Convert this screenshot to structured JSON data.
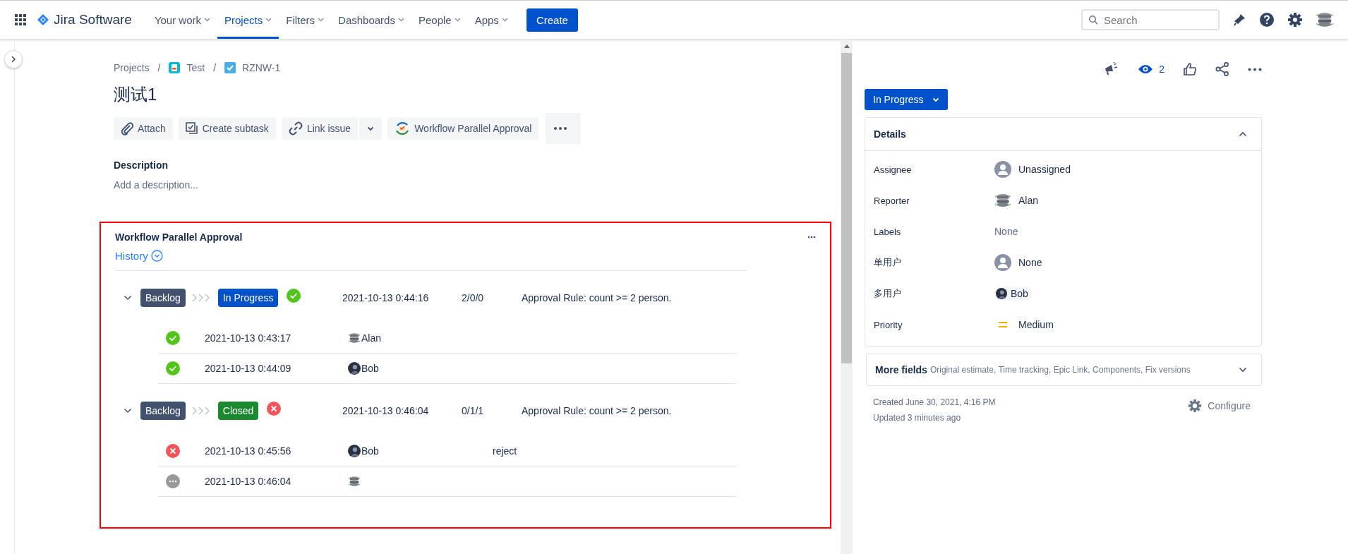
{
  "nav": {
    "app_name": "Jira Software",
    "items": [
      {
        "label": "Your work",
        "selected": false
      },
      {
        "label": "Projects",
        "selected": true
      },
      {
        "label": "Filters",
        "selected": false
      },
      {
        "label": "Dashboards",
        "selected": false
      },
      {
        "label": "People",
        "selected": false
      },
      {
        "label": "Apps",
        "selected": false
      }
    ],
    "create": "Create",
    "search": {
      "placeholder": "Search"
    }
  },
  "breadcrumbs": [
    {
      "label": "Projects",
      "kind": "text"
    },
    {
      "separator": "/",
      "label": "Test",
      "kind": "project"
    },
    {
      "separator": "/",
      "label": "RZNW-1",
      "kind": "task"
    }
  ],
  "issue": {
    "title": "测试1",
    "actions": [
      {
        "label": "Attach",
        "kind": "attach"
      },
      {
        "label": "Create subtask",
        "kind": "subtask"
      },
      {
        "label": "Link issue",
        "kind": "link"
      },
      {
        "label": "Workflow Parallel Approval",
        "kind": "approval"
      }
    ],
    "description_label": "Description",
    "description_placeholder": "Add a description..."
  },
  "approval": {
    "title": "Workflow Parallel Approval",
    "history_label": "History",
    "groups": [
      {
        "expanded": true,
        "from": {
          "label": "Backlog",
          "color": "#42526e"
        },
        "to": {
          "label": "In Progress",
          "color": "#0052cc"
        },
        "kind": "approved",
        "time": "2021-10-13 0:44:16",
        "counts": "2/0/0",
        "rule": "Approval Rule: count >= 2 person.",
        "entries": [
          {
            "kind": "approved",
            "time": "2021-10-13 0:43:17",
            "avatar": {
              "kind": "server"
            },
            "user": "Alan"
          },
          {
            "kind": "approved",
            "time": "2021-10-13 0:44:09",
            "avatar": {
              "kind": "photo"
            },
            "user": "Bob"
          }
        ]
      },
      {
        "expanded": true,
        "from": {
          "label": "Backlog",
          "color": "#42526e"
        },
        "to": {
          "label": "Closed",
          "color": "#1a8a2e"
        },
        "kind": "rejected",
        "time": "2021-10-13 0:46:04",
        "counts": "0/1/1",
        "rule": "Approval Rule: count >= 2 person.",
        "entries": [
          {
            "kind": "rejected",
            "time": "2021-10-13 0:45:56",
            "avatar": {
              "kind": "photo"
            },
            "user": "Bob",
            "comment": "reject"
          },
          {
            "kind": "pending",
            "time": "2021-10-13 0:46:04",
            "avatar": {
              "kind": "server"
            }
          }
        ]
      }
    ]
  },
  "side": {
    "watchers": "2",
    "status_button": "In Progress",
    "details": {
      "title": "Details",
      "expanded": true,
      "fields": [
        {
          "label": "Assignee",
          "value": "Unassigned",
          "kind": "empty-person"
        },
        {
          "label": "Reporter",
          "value": "Alan",
          "kind": "server"
        },
        {
          "label": "Labels",
          "value": "None",
          "kind": "plain"
        },
        {
          "label": "单用户",
          "value": "None",
          "kind": "empty-person"
        },
        {
          "label": "多用户",
          "value": "Bob",
          "kind": "chip"
        },
        {
          "label": "Priority",
          "value": "Medium",
          "kind": "priority"
        }
      ]
    },
    "more_fields": {
      "title": "More fields",
      "hint": "Original estimate, Time tracking, Epic Link, Components, Fix versions",
      "expanded": false
    },
    "created": "Created June 30, 2021, 4:16 PM",
    "updated": "Updated 3 minutes ago",
    "configure": "Configure"
  }
}
